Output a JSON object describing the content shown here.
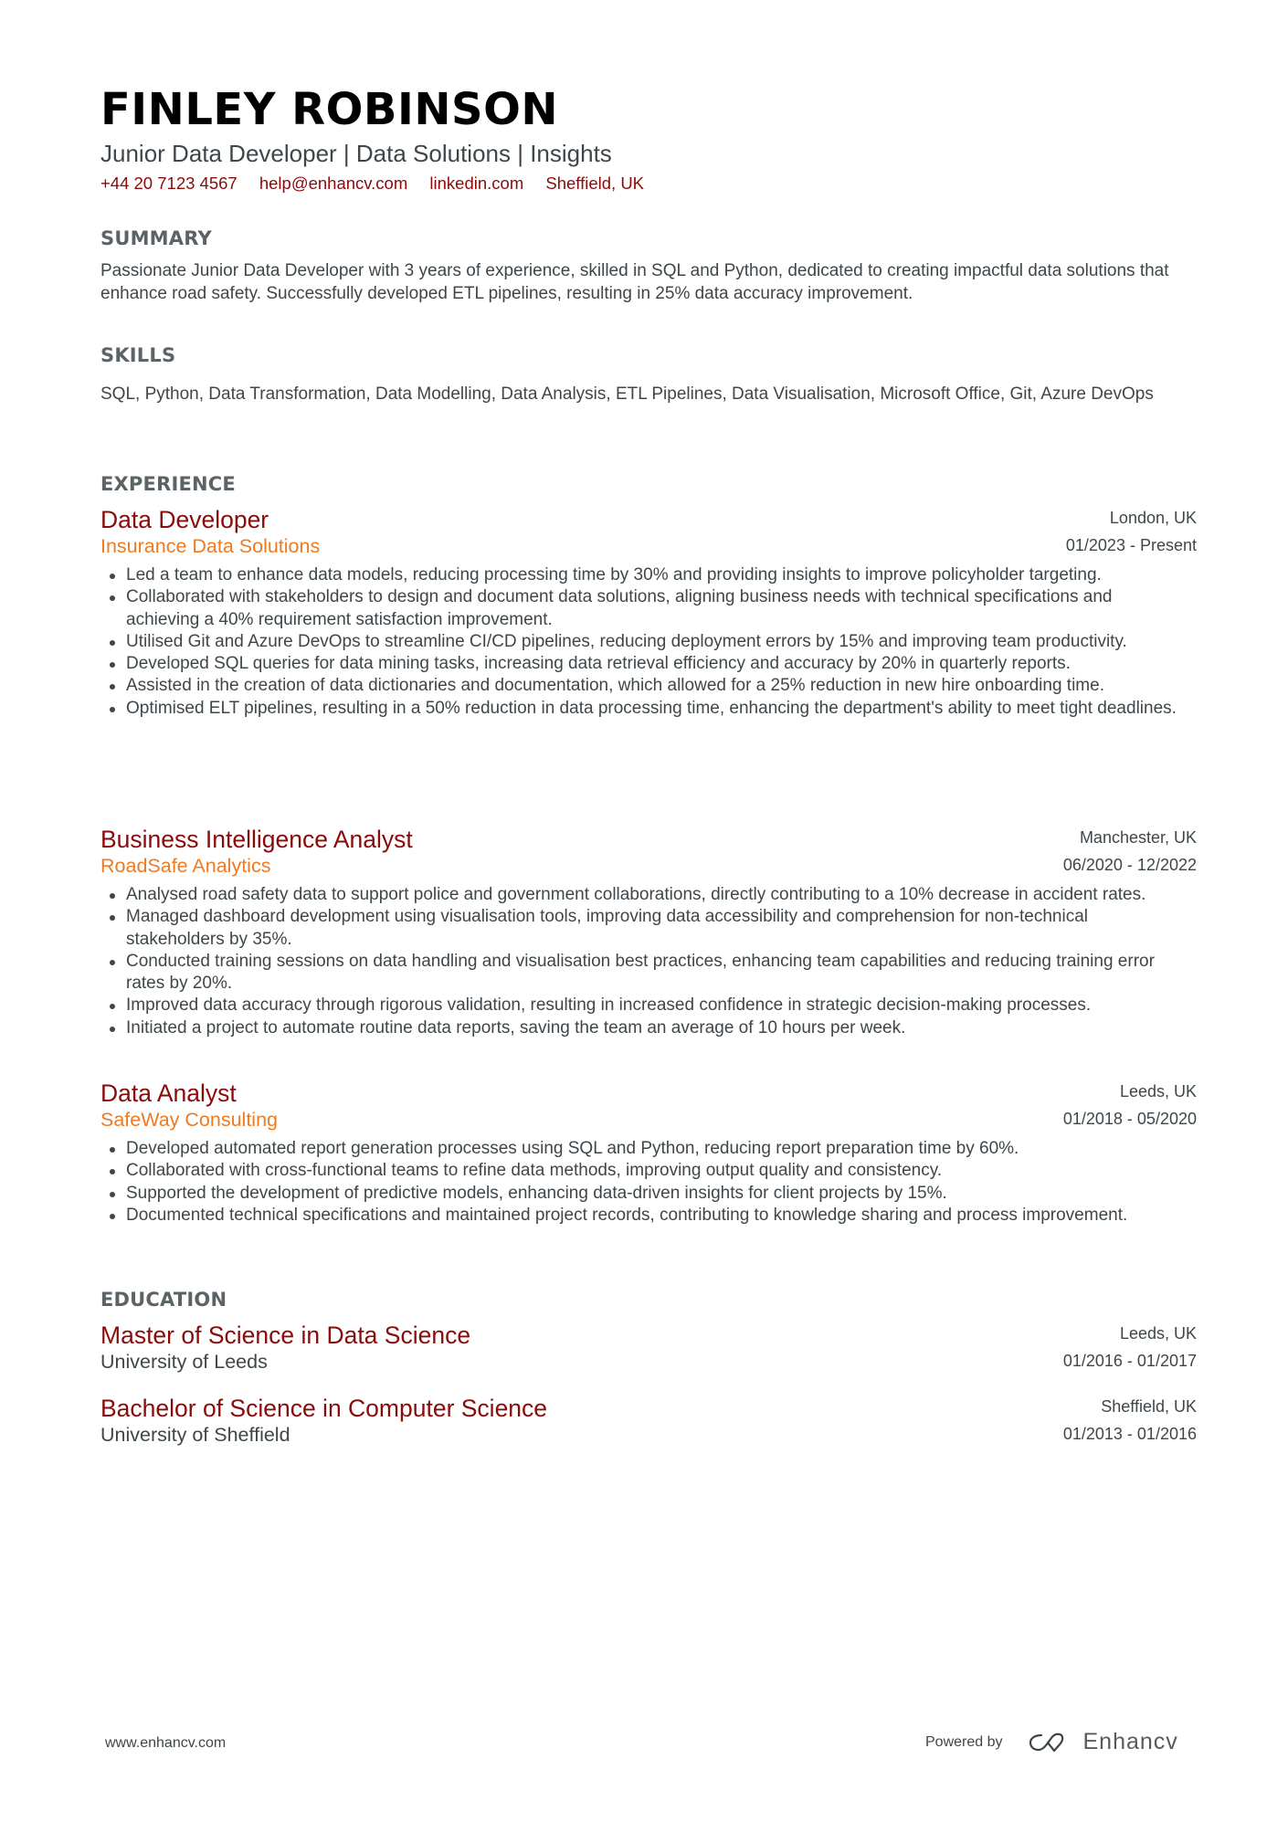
{
  "header": {
    "name": "FINLEY ROBINSON",
    "headline": "Junior Data Developer | Data Solutions | Insights",
    "contacts": {
      "phone": "+44 20 7123 4567",
      "email": "help@enhancv.com",
      "linkedin": "linkedin.com",
      "location": "Sheffield, UK"
    }
  },
  "summary": {
    "heading": "SUMMARY",
    "text": "Passionate Junior Data Developer with 3 years of experience, skilled in SQL and Python, dedicated to creating impactful data solutions that enhance road safety. Successfully developed ETL pipelines, resulting in 25% data accuracy improvement."
  },
  "skills": {
    "heading": "SKILLS",
    "text": "SQL, Python, Data Transformation, Data Modelling, Data Analysis, ETL Pipelines, Data Visualisation, Microsoft Office, Git, Azure DevOps"
  },
  "experience": {
    "heading": "EXPERIENCE",
    "jobs": [
      {
        "title": "Data Developer",
        "company": "Insurance Data Solutions",
        "location": "London, UK",
        "dates": "01/2023 - Present",
        "bullets": [
          "Led a team to enhance data models, reducing processing time by 30% and providing insights to improve policyholder targeting.",
          "Collaborated with stakeholders to design and document data solutions, aligning business needs with technical specifications and achieving a 40% requirement satisfaction improvement.",
          "Utilised Git and Azure DevOps to streamline CI/CD pipelines, reducing deployment errors by 15% and improving team productivity.",
          "Developed SQL queries for data mining tasks, increasing data retrieval efficiency and accuracy by 20% in quarterly reports.",
          "Assisted in the creation of data dictionaries and documentation, which allowed for a 25% reduction in new hire onboarding time.",
          "Optimised ELT pipelines, resulting in a 50% reduction in data processing time, enhancing the department's ability to meet tight deadlines."
        ]
      },
      {
        "title": "Business Intelligence Analyst",
        "company": "RoadSafe Analytics",
        "location": "Manchester, UK",
        "dates": "06/2020 - 12/2022",
        "bullets": [
          "Analysed road safety data to support police and government collaborations, directly contributing to a 10% decrease in accident rates.",
          "Managed dashboard development using visualisation tools, improving data accessibility and comprehension for non-technical stakeholders by 35%.",
          "Conducted training sessions on data handling and visualisation best practices, enhancing team capabilities and reducing training error rates by 20%.",
          "Improved data accuracy through rigorous validation, resulting in increased confidence in strategic decision-making processes.",
          "Initiated a project to automate routine data reports, saving the team an average of 10 hours per week."
        ]
      },
      {
        "title": "Data Analyst",
        "company": "SafeWay Consulting",
        "location": "Leeds, UK",
        "dates": "01/2018 - 05/2020",
        "bullets": [
          "Developed automated report generation processes using SQL and Python, reducing report preparation time by 60%.",
          "Collaborated with cross-functional teams to refine data methods, improving output quality and consistency.",
          "Supported the development of predictive models, enhancing data-driven insights for client projects by 15%.",
          "Documented technical specifications and maintained project records, contributing to knowledge sharing and process improvement."
        ]
      }
    ]
  },
  "education": {
    "heading": "EDUCATION",
    "items": [
      {
        "degree": "Master of Science in Data Science",
        "school": "University of Leeds",
        "location": "Leeds, UK",
        "dates": "01/2016 - 01/2017"
      },
      {
        "degree": "Bachelor of Science in Computer Science",
        "school": "University of Sheffield",
        "location": "Sheffield, UK",
        "dates": "01/2013 - 01/2016"
      }
    ]
  },
  "footer": {
    "website": "www.enhancv.com",
    "powered_by": "Powered by",
    "brand": "Enhancv",
    "logo_icon": "enhancv-logo-icon"
  },
  "colors": {
    "name": "#000000",
    "accent_title": "#8b0a0a",
    "accent_company": "#f07a22",
    "section_heading": "#5b6367",
    "body_text": "#3f464a"
  }
}
